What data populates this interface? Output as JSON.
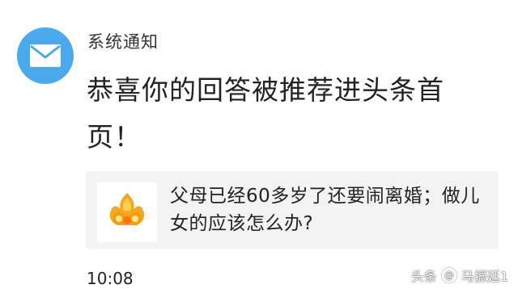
{
  "notification": {
    "sender": "系统通知",
    "avatar_icon": "mail-icon",
    "avatar_color": "#4aa8ec",
    "message": "恭喜你的回答被推荐进头条首页！",
    "time": "10:08"
  },
  "article_card": {
    "title": "父母已经60多岁了还要闹离婚；做儿女的应该怎么办?",
    "thumbnail_icon": "toutiao-qa-logo-icon",
    "background": "#f3f3f3"
  },
  "watermark": {
    "platform": "头条",
    "at_symbol": "@",
    "author": "马振廷1"
  }
}
